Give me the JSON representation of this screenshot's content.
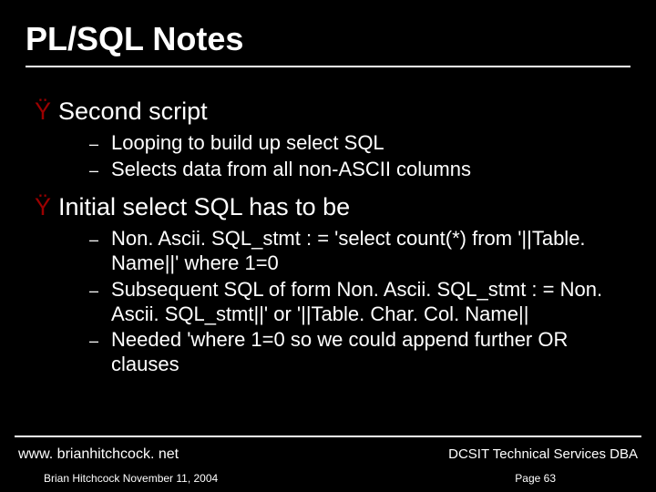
{
  "title": "PL/SQL Notes",
  "items": [
    {
      "label": "Second script",
      "sub": [
        "Looping to build up select SQL",
        "Selects data from all non-ASCII columns"
      ]
    },
    {
      "label": "Initial select SQL has to be",
      "sub": [
        "Non. Ascii. SQL_stmt : = 'select count(*) from '||Table. Name||' where 1=0",
        "Subsequent SQL of form Non. Ascii. SQL_stmt : = Non. Ascii. SQL_stmt||' or '||Table. Char. Col. Name||",
        "Needed 'where 1=0 so we could append further OR clauses"
      ]
    }
  ],
  "footer": {
    "url": "www. brianhitchcock. net",
    "right": "DCSIT Technical Services DBA",
    "author": "Brian Hitchcock  November 11, 2004",
    "page": "Page 63"
  },
  "bullet_level1": "Ÿ",
  "bullet_level2": "–"
}
